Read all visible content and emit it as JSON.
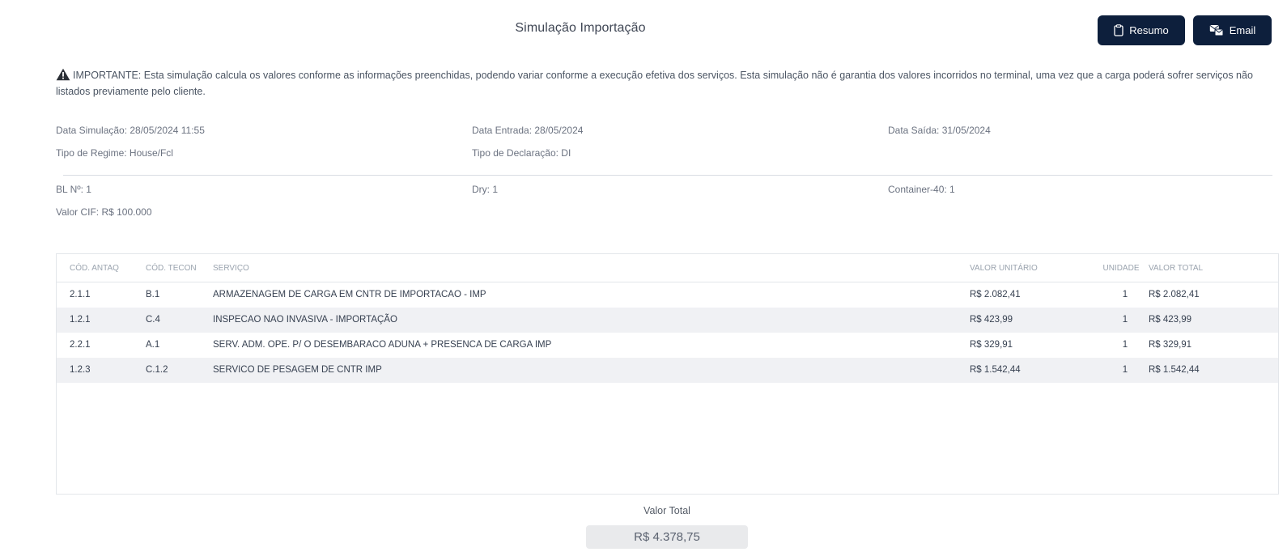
{
  "header": {
    "title": "Simulação Importação",
    "resumo_label": "Resumo",
    "email_label": "Email"
  },
  "warning": {
    "icon": "warning-triangle-icon",
    "text": "IMPORTANTE: Esta simulação calcula os valores conforme as informações preenchidas, podendo variar conforme a execução efetiva dos serviços. Esta simulação não é garantia dos valores incorridos no terminal, uma vez que a carga poderá sofrer serviços não listados previamente pelo cliente."
  },
  "info": {
    "data_simulacao": "Data Simulação: 28/05/2024 11:55",
    "data_entrada": "Data Entrada: 28/05/2024",
    "data_saida": "Data Saída: 31/05/2024",
    "tipo_regime": "Tipo de Regime: House/Fcl",
    "tipo_declaracao": "Tipo de Declaração: DI",
    "bl": "BL Nº: 1",
    "dry": "Dry: 1",
    "container": "Container-40: 1",
    "valor_cif": "Valor CIF: R$ 100.000"
  },
  "table": {
    "headers": {
      "cod_antaq": "CÓD. ANTAQ",
      "cod_tecon": "CÓD. TECON",
      "servico": "SERVIÇO",
      "valor_unitario": "VALOR UNITÁRIO",
      "unidade": "UNIDADE",
      "valor_total": "VALOR TOTAL"
    },
    "rows": [
      {
        "cod_antaq": "2.1.1",
        "cod_tecon": "B.1",
        "servico": "ARMAZENAGEM DE CARGA EM CNTR DE IMPORTACAO - IMP",
        "valor_unitario": "R$ 2.082,41",
        "unidade": "1",
        "valor_total": "R$ 2.082,41"
      },
      {
        "cod_antaq": "1.2.1",
        "cod_tecon": "C.4",
        "servico": "INSPECAO NAO INVASIVA - IMPORTAÇÃO",
        "valor_unitario": "R$ 423,99",
        "unidade": "1",
        "valor_total": "R$ 423,99"
      },
      {
        "cod_antaq": "2.2.1",
        "cod_tecon": "A.1",
        "servico": "SERV. ADM. OPE. P/ O DESEMBARACO ADUNA + PRESENCA DE CARGA IMP",
        "valor_unitario": "R$ 329,91",
        "unidade": "1",
        "valor_total": "R$ 329,91"
      },
      {
        "cod_antaq": "1.2.3",
        "cod_tecon": "C.1.2",
        "servico": "SERVICO DE PESAGEM DE CNTR IMP",
        "valor_unitario": "R$ 1.542,44",
        "unidade": "1",
        "valor_total": "R$ 1.542,44"
      }
    ]
  },
  "total": {
    "label": "Valor Total",
    "value": "R$ 4.378,75"
  },
  "colors": {
    "button_bg": "#0d1f3c",
    "row_alt_bg": "#f0f1f4",
    "total_box_bg": "#e9eaec"
  }
}
